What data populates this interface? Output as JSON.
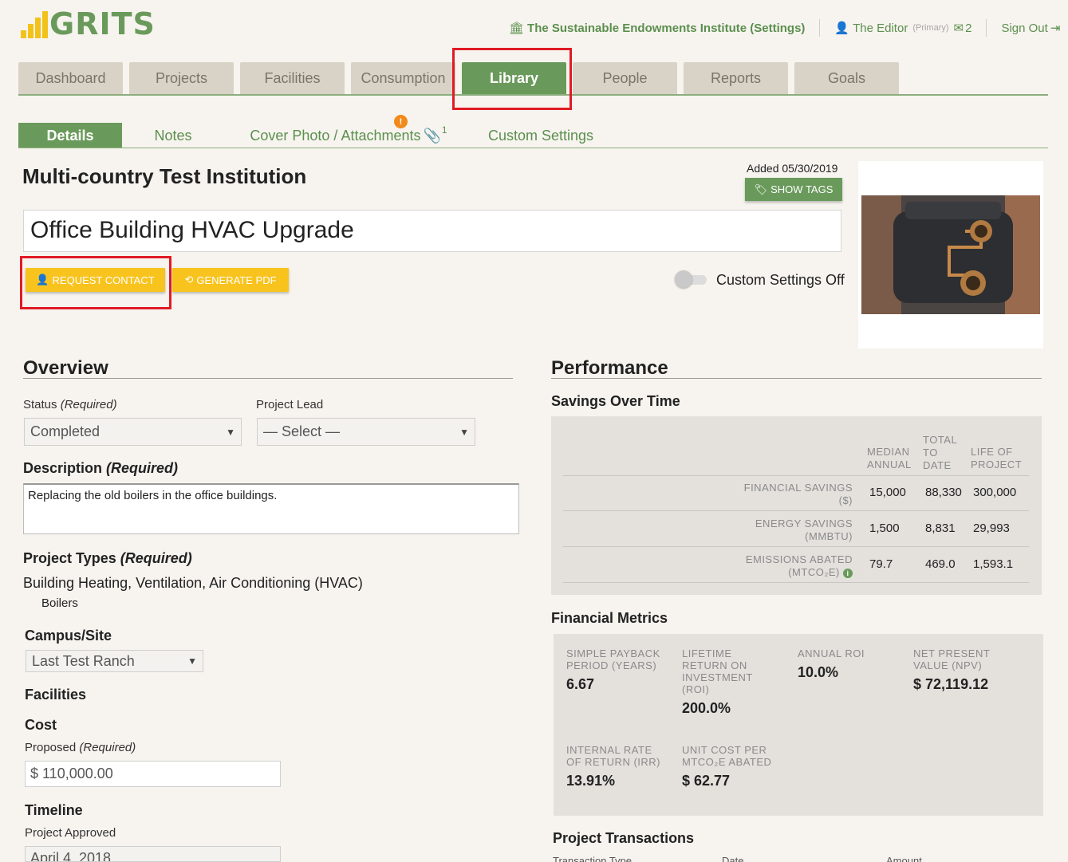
{
  "header": {
    "logo_text": "GRITS",
    "institution_link": "The Sustainable Endowments Institute (Settings)",
    "user_name": "The Editor",
    "user_role": "(Primary)",
    "message_count": "2",
    "sign_out": "Sign Out"
  },
  "main_tabs": [
    {
      "label": "Dashboard"
    },
    {
      "label": "Projects"
    },
    {
      "label": "Facilities"
    },
    {
      "label": "Consumption"
    },
    {
      "label": "Library"
    },
    {
      "label": "People"
    },
    {
      "label": "Reports"
    },
    {
      "label": "Goals"
    }
  ],
  "active_main_tab": "Library",
  "sub_tabs": [
    {
      "label": "Details"
    },
    {
      "label": "Notes"
    },
    {
      "label": "Cover Photo / Attachments"
    },
    {
      "label": "Custom Settings"
    }
  ],
  "attachments_count": "1",
  "attachments_alert": "!",
  "institution_name": "Multi-country Test Institution",
  "added_date": "Added 05/30/2019",
  "show_tags_label": "SHOW TAGS",
  "project_title": "Office Building HVAC Upgrade",
  "request_contact_label": "REQUEST CONTACT",
  "generate_pdf_label": "GENERATE PDF",
  "custom_settings_toggle_label": "Custom Settings Off",
  "overview": {
    "title": "Overview",
    "status_label": "Status",
    "required": "(Required)",
    "status_value": "Completed",
    "project_lead_label": "Project Lead",
    "project_lead_value": "— Select —",
    "description_label": "Description",
    "description_value": "Replacing the old boilers in the office buildings.",
    "project_types_label": "Project Types",
    "project_type": "Building Heating, Ventilation, Air Conditioning (HVAC)",
    "project_subtype": "Boilers",
    "campus_label": "Campus/Site",
    "campus_value": "Last Test Ranch",
    "facilities_label": "Facilities",
    "cost_label": "Cost",
    "proposed_label": "Proposed",
    "proposed_value": "$ 110,000.00",
    "timeline_label": "Timeline",
    "project_approved_label": "Project Approved",
    "project_approved_value": "April 4, 2018"
  },
  "performance": {
    "title": "Performance",
    "savings_title": "Savings Over Time",
    "col_median": [
      "MEDIAN",
      "ANNUAL"
    ],
    "col_total": [
      "TOTAL",
      "TO",
      "DATE"
    ],
    "col_life": [
      "LIFE OF",
      "PROJECT"
    ],
    "rows": [
      {
        "label1": "FINANCIAL SAVINGS",
        "label2": "($)",
        "median": "15,000",
        "total": "88,330",
        "life": "300,000"
      },
      {
        "label1": "ENERGY SAVINGS",
        "label2": "(MMBTU)",
        "median": "1,500",
        "total": "8,831",
        "life": "29,993"
      },
      {
        "label1": "EMISSIONS ABATED",
        "label2": "(MTCO₂E)",
        "median": "79.7",
        "total": "469.0",
        "life": "1,593.1"
      }
    ],
    "financial_title": "Financial Metrics",
    "metrics": [
      {
        "label": [
          "SIMPLE PAYBACK",
          "PERIOD (YEARS)"
        ],
        "value": "6.67"
      },
      {
        "label": [
          "LIFETIME",
          "RETURN ON",
          "INVESTMENT",
          "(ROI)"
        ],
        "value": "200.0%"
      },
      {
        "label": [
          "ANNUAL ROI"
        ],
        "value": "10.0%"
      },
      {
        "label": [
          "NET PRESENT",
          "VALUE (NPV)"
        ],
        "value": "$ 72,119.12"
      },
      {
        "label": [
          "INTERNAL RATE",
          "OF RETURN (IRR)"
        ],
        "value": "13.91%"
      },
      {
        "label": [
          "UNIT COST PER",
          "MTCO₂E ABATED"
        ],
        "value": "$ 62.77"
      }
    ],
    "transactions_title": "Project Transactions",
    "transactions_cols": [
      "Transaction Type",
      "Date",
      "Amount"
    ]
  },
  "colors": {
    "brand_green": "#6a9a5b",
    "brand_yellow": "#f9c31e",
    "highlight_red": "#e01b24"
  }
}
